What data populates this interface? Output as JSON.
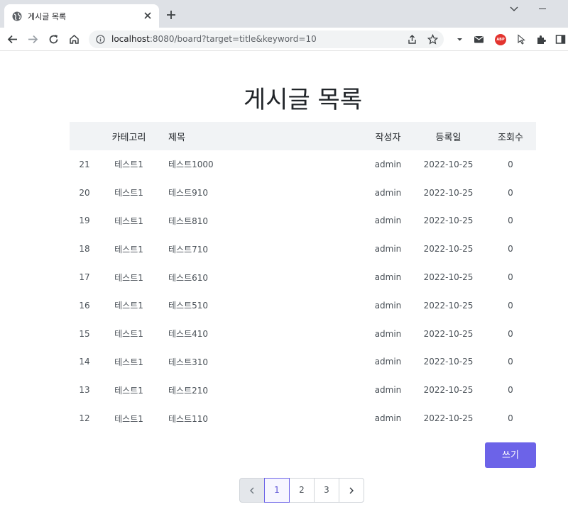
{
  "browser": {
    "tab_title": "게시글 목록",
    "url_host": "localhost",
    "url_rest": ":8080/board?target=title&keyword=10",
    "abp_label": "ABP",
    "icons": [
      "globe-icon",
      "close-icon",
      "plus-icon",
      "chevron-down-icon",
      "minimize-icon",
      "back-arrow-icon",
      "forward-arrow-icon",
      "reload-icon",
      "home-icon",
      "info-icon",
      "share-icon",
      "star-icon",
      "menu-caret-icon",
      "mail-icon",
      "adblock-icon",
      "cursor-extension-icon",
      "puzzle-icon",
      "side-panel-icon"
    ]
  },
  "page": {
    "title": "게시글 목록"
  },
  "table": {
    "headers": {
      "no": "",
      "category": "카테고리",
      "title": "제목",
      "writer": "작성자",
      "date": "등록일",
      "views": "조회수"
    },
    "rows": [
      {
        "no": "21",
        "category": "테스트1",
        "title": "테스트1000",
        "writer": "admin",
        "date": "2022-10-25",
        "views": "0"
      },
      {
        "no": "20",
        "category": "테스트1",
        "title": "테스트910",
        "writer": "admin",
        "date": "2022-10-25",
        "views": "0"
      },
      {
        "no": "19",
        "category": "테스트1",
        "title": "테스트810",
        "writer": "admin",
        "date": "2022-10-25",
        "views": "0"
      },
      {
        "no": "18",
        "category": "테스트1",
        "title": "테스트710",
        "writer": "admin",
        "date": "2022-10-25",
        "views": "0"
      },
      {
        "no": "17",
        "category": "테스트1",
        "title": "테스트610",
        "writer": "admin",
        "date": "2022-10-25",
        "views": "0"
      },
      {
        "no": "16",
        "category": "테스트1",
        "title": "테스트510",
        "writer": "admin",
        "date": "2022-10-25",
        "views": "0"
      },
      {
        "no": "15",
        "category": "테스트1",
        "title": "테스트410",
        "writer": "admin",
        "date": "2022-10-25",
        "views": "0"
      },
      {
        "no": "14",
        "category": "테스트1",
        "title": "테스트310",
        "writer": "admin",
        "date": "2022-10-25",
        "views": "0"
      },
      {
        "no": "13",
        "category": "테스트1",
        "title": "테스트210",
        "writer": "admin",
        "date": "2022-10-25",
        "views": "0"
      },
      {
        "no": "12",
        "category": "테스트1",
        "title": "테스트110",
        "writer": "admin",
        "date": "2022-10-25",
        "views": "0"
      }
    ]
  },
  "write_button": {
    "label": "쓰기",
    "color": "#6c63e8"
  },
  "pagination": {
    "pages": [
      "1",
      "2",
      "3"
    ],
    "current": "1",
    "prev_icon": "chevron-left-icon",
    "next_icon": "chevron-right-icon"
  }
}
